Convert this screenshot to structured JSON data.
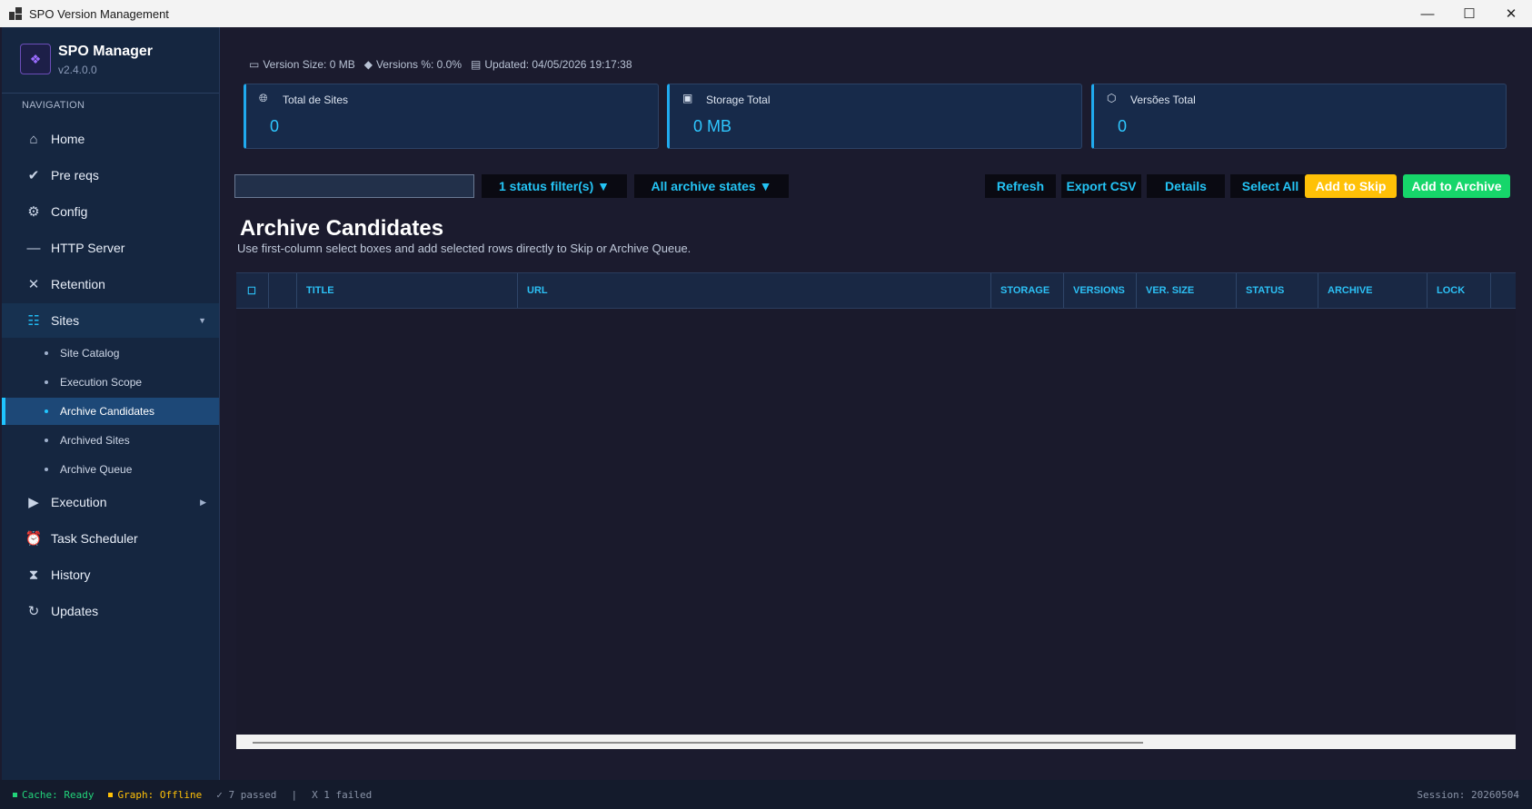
{
  "window": {
    "title": "SPO Version Management",
    "minimize": "—",
    "maximize": "☐",
    "close": "✕"
  },
  "brand": {
    "name": "SPO Manager",
    "version": "v2.4.0.0"
  },
  "navigation": {
    "label": "NAVIGATION",
    "items": [
      {
        "label": "Home",
        "icon": "home-icon"
      },
      {
        "label": "Pre reqs",
        "icon": "checkmark-icon"
      },
      {
        "label": "Config",
        "icon": "gear-icon"
      },
      {
        "label": "HTTP Server",
        "icon": "minus-icon"
      },
      {
        "label": "Retention",
        "icon": "x-icon"
      },
      {
        "label": "Sites",
        "icon": "list-icon"
      },
      {
        "label": "Execution",
        "icon": "play-icon"
      },
      {
        "label": "Task Scheduler",
        "icon": "alarm-icon"
      },
      {
        "label": "History",
        "icon": "hourglass-icon"
      },
      {
        "label": "Updates",
        "icon": "refresh-icon"
      }
    ],
    "sites_sub": [
      "Site Catalog",
      "Execution Scope",
      "Archive Candidates",
      "Archived Sites",
      "Archive Queue"
    ]
  },
  "meta": {
    "version_size": "Version Size: 0 MB",
    "versions_pct": "Versions %: 0.0%",
    "updated": "Updated: 04/05/2026 19:17:38"
  },
  "cards": [
    {
      "label": "Total de Sites",
      "value": "0",
      "icon": "globe-icon"
    },
    {
      "label": "Storage Total",
      "value": "0 MB",
      "icon": "save-icon"
    },
    {
      "label": "Versões Total",
      "value": "0",
      "icon": "box-icon"
    }
  ],
  "toolbar": {
    "search_value": "",
    "status_filter": "1 status filter(s) ▼",
    "archive_states": "All archive states ▼",
    "refresh": "Refresh",
    "export_csv": "Export CSV",
    "details": "Details",
    "select_all": "Select All",
    "add_to_skip": "Add to Skip",
    "add_to_archive": "Add to Archive"
  },
  "page": {
    "title": "Archive Candidates",
    "subtitle": "Use first-column select boxes and add selected rows directly to Skip or Archive Queue."
  },
  "table": {
    "select_glyph": "☐",
    "columns": [
      "TITLE",
      "URL",
      "STORAGE",
      "VERSIONS",
      "VER. SIZE",
      "STATUS",
      "ARCHIVE",
      "LOCK"
    ]
  },
  "statusbar": {
    "cache": "Cache: Ready",
    "graph": "Graph: Offline",
    "passed": "✓ 7 passed",
    "divider": "|",
    "failed": "X 1 failed",
    "session": "Session: 20260504"
  },
  "colors": {
    "accent": "#24c4f5",
    "skip": "#ffc107",
    "archive": "#16d66a",
    "cache_ok": "#22d37a",
    "graph_offline": "#ffc107"
  }
}
